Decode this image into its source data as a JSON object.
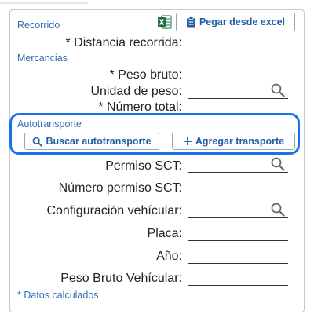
{
  "sections": {
    "recorrido": "Recorrido",
    "mercancias": "Mercancias",
    "autotransporte": "Autotransporte"
  },
  "buttons": {
    "pegar_excel": "Pegar desde excel",
    "buscar": "Buscar autotransporte",
    "agregar": "Agregar transporte"
  },
  "fields": {
    "distancia": "* Distancia recorrida:",
    "peso_bruto": "* Peso bruto:",
    "unidad_peso": "Unidad de peso:",
    "numero_total": "* Número total:",
    "permiso_sct": "Permiso SCT:",
    "numero_permiso": "Número permiso SCT:",
    "config_vehicular": "Configuración vehícular:",
    "placa": "Placa:",
    "anio": "Año:",
    "peso_vehicular": "Peso Bruto Vehícular:"
  },
  "footer_note": "* Datos calculados",
  "icons": {
    "excel": "excel-icon",
    "clipboard": "clipboard-icon",
    "search": "search-icon",
    "plus": "plus-icon"
  },
  "colors": {
    "accent_blue": "#1f5fa6",
    "highlight_border": "#1a73e8",
    "excel_green": "#1d6f42"
  }
}
